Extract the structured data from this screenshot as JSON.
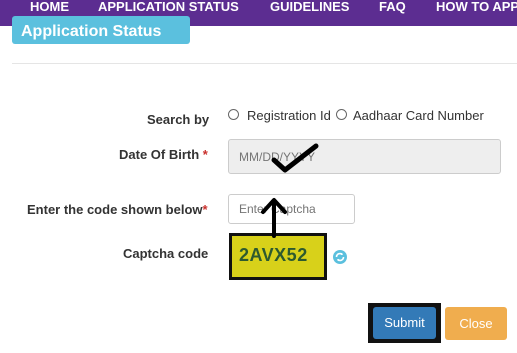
{
  "nav": {
    "home": "HOME",
    "application_status": "APPLICATION STATUS",
    "guidelines": "GUIDELINES",
    "faq": "FAQ",
    "how_to": "HOW TO APP"
  },
  "section": {
    "title": "Application Status"
  },
  "form": {
    "search_by_label": "Search by",
    "search_options": [
      "Registration Id",
      "Aadhaar Card Number"
    ],
    "dob_label": "Date Of Birth",
    "dob_placeholder": "MM/DD/YYYY",
    "code_label": "Enter the code shown below",
    "code_placeholder": "Enter Captcha",
    "captcha_label": "Captcha code",
    "captcha_value": "2AVX52",
    "required_marker": "*"
  },
  "buttons": {
    "submit": "Submit",
    "close": "Close"
  },
  "icons": {
    "refresh": "refresh-icon"
  },
  "colors": {
    "nav_bg": "#5c2d91",
    "header_tab": "#5bc0de",
    "submit": "#337ab7",
    "close": "#f0ad4e",
    "captcha_bg": "#d8d11a"
  }
}
